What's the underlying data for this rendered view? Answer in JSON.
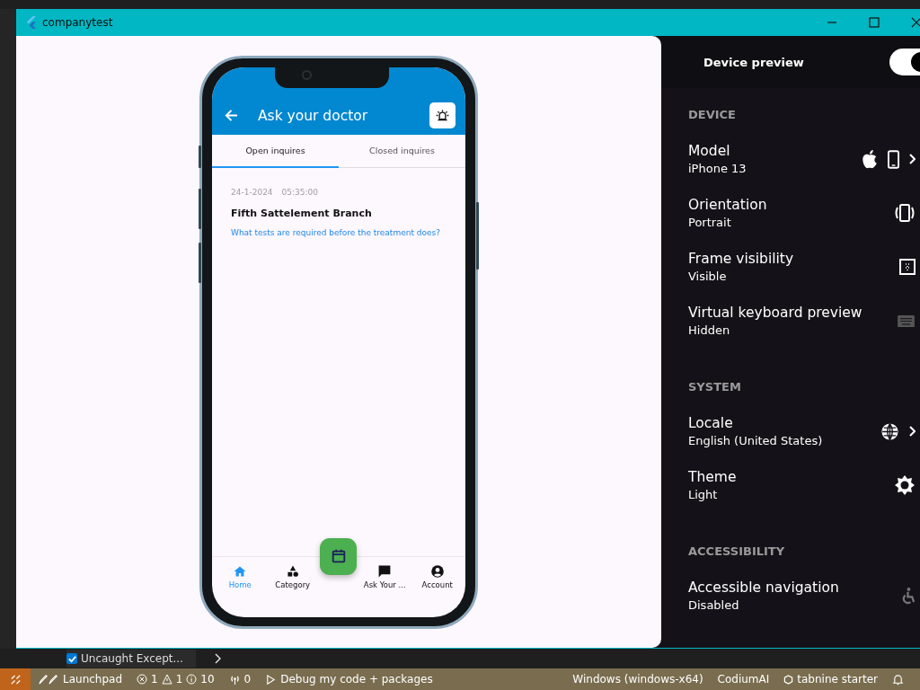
{
  "window": {
    "title": "companytest"
  },
  "app_bar": {
    "title": "Ask your doctor"
  },
  "tabs": [
    {
      "label": "Open inquires",
      "selected": true
    },
    {
      "label": "Closed inquires",
      "selected": false
    }
  ],
  "inquiries": [
    {
      "date": "24-1-2024",
      "time": "05:35:00",
      "branch": "Fifth Sattelement Branch",
      "question": "What tests are required before the treatment does?"
    }
  ],
  "bottom_nav": [
    {
      "kind": "home",
      "label": "Home",
      "selected": true
    },
    {
      "kind": "category",
      "label": "Category",
      "selected": false
    },
    {
      "kind": "chat",
      "label": "Ask Your ...",
      "selected": false
    },
    {
      "kind": "account",
      "label": "Account",
      "selected": false
    }
  ],
  "device_preview": {
    "title": "Device preview",
    "on": true
  },
  "sections": [
    {
      "title": "DEVICE",
      "rows": [
        {
          "kind": "model",
          "label": "Model",
          "value": "iPhone 13"
        },
        {
          "kind": "orientation",
          "label": "Orientation",
          "value": "Portrait"
        },
        {
          "kind": "frame",
          "label": "Frame visibility",
          "value": "Visible"
        },
        {
          "kind": "keyboard",
          "label": "Virtual keyboard preview",
          "value": "Hidden"
        }
      ]
    },
    {
      "title": "SYSTEM",
      "rows": [
        {
          "kind": "locale",
          "label": "Locale",
          "value": "English (United States)"
        },
        {
          "kind": "theme",
          "label": "Theme",
          "value": "Light"
        }
      ]
    },
    {
      "title": "ACCESSIBILITY",
      "rows": [
        {
          "kind": "accessibility",
          "label": "Accessible navigation",
          "value": "Disabled"
        }
      ]
    }
  ],
  "problems_filter": {
    "label": "Uncaught Except...",
    "checked": true
  },
  "status_bar": {
    "left": [
      {
        "kind": "launchpad",
        "text": "Launchpad"
      },
      {
        "kind": "problems",
        "errors": "1",
        "warnings": "1",
        "infos": "10"
      },
      {
        "kind": "ports",
        "text": "0"
      },
      {
        "kind": "debug",
        "text": "Debug my code + packages"
      }
    ],
    "right": [
      {
        "kind": "plain",
        "text": "Windows (windows-x64)"
      },
      {
        "kind": "plain",
        "text": "CodiumAI"
      },
      {
        "kind": "tabnine",
        "text": "tabnine starter"
      },
      {
        "kind": "bell"
      }
    ]
  }
}
